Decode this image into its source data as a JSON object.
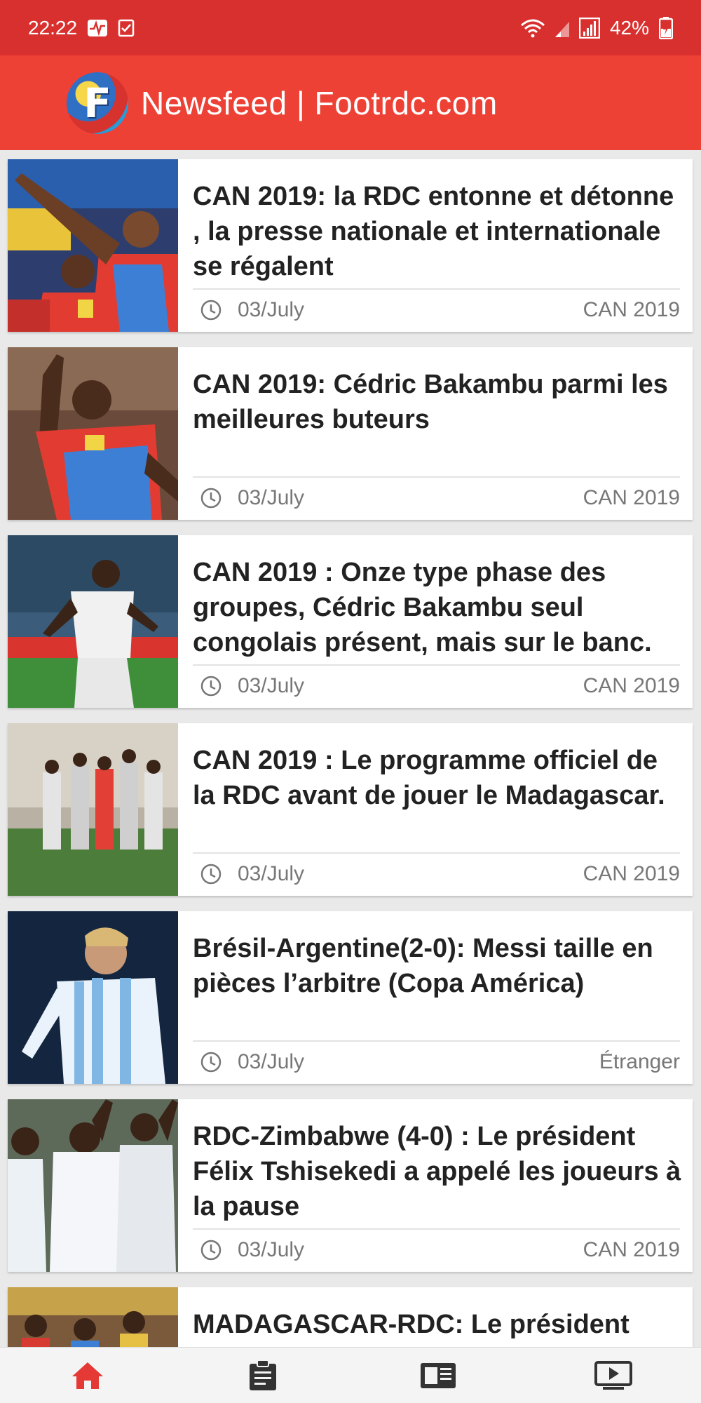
{
  "status_bar": {
    "time": "22:22",
    "battery": "42%"
  },
  "app_bar": {
    "logo_letter": "F",
    "title": "Newsfeed | Footrdc.com"
  },
  "colors": {
    "status_bar": "#d8302e",
    "app_bar": "#ee4136",
    "nav_active": "#e53935",
    "nav_inactive": "#333333"
  },
  "articles": [
    {
      "title": "CAN 2019: la RDC entonne et détonne , la presse nationale et internationale se régalent",
      "date": "03/July",
      "category": "CAN 2019"
    },
    {
      "title": "CAN 2019: Cédric Bakambu parmi les meilleures buteurs",
      "date": "03/July",
      "category": "CAN 2019"
    },
    {
      "title": "CAN 2019 : Onze type phase des groupes, Cédric Bakambu seul congolais présent, mais sur le banc.",
      "date": "03/July",
      "category": "CAN 2019"
    },
    {
      "title": "CAN 2019 : Le programme officiel de la RDC avant de jouer le Madagascar.",
      "date": "03/July",
      "category": "CAN 2019"
    },
    {
      "title": "Brésil-Argentine(2-0): Messi taille en pièces l’arbitre (Copa América)",
      "date": "03/July",
      "category": "Étranger"
    },
    {
      "title": "RDC-Zimbabwe (4-0) : Le président Félix Tshisekedi a appelé les joueurs à la pause",
      "date": "03/July",
      "category": "CAN 2019"
    },
    {
      "title": "MADAGASCAR-RDC: Le président",
      "date": "",
      "category": ""
    }
  ],
  "bottom_nav": [
    {
      "icon": "home-icon",
      "active": true
    },
    {
      "icon": "clipboard-icon",
      "active": false
    },
    {
      "icon": "newspaper-icon",
      "active": false
    },
    {
      "icon": "video-icon",
      "active": false
    }
  ]
}
